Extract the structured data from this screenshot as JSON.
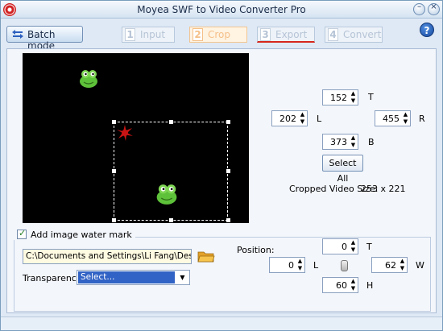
{
  "window": {
    "title": "Moyea SWF to Video Converter Pro"
  },
  "titlebar_buttons": [
    {
      "name": "minimize-button",
      "glyph": "–"
    },
    {
      "name": "close-button",
      "glyph": "×"
    }
  ],
  "toolbar": {
    "batch_mode_label": "Batch mode",
    "help_glyph": "?",
    "steps": [
      {
        "num": "1",
        "label": "Input"
      },
      {
        "num": "2",
        "label": "Crop"
      },
      {
        "num": "3",
        "label": "Export"
      },
      {
        "num": "4",
        "label": "Convert"
      }
    ]
  },
  "crop": {
    "top": "152",
    "top_label": "T",
    "left": "202",
    "left_label": "L",
    "right": "455",
    "right_label": "R",
    "bottom": "373",
    "bottom_label": "B",
    "select_all_label": "Select All",
    "cropped_size_label": "Cropped Video Size:",
    "cropped_size_value": "253 x 221"
  },
  "watermark": {
    "checkbox_label": "Add image water mark",
    "checked": true,
    "path_value": "C:\\Documents and Settings\\Li Fang\\Desktop\\Lo",
    "transparency_label": "Transparency:",
    "transparency_value": "Select...",
    "position_label": "Position:",
    "top": "0",
    "top_label": "T",
    "left": "0",
    "left_label": "L",
    "width": "62",
    "width_label": "W",
    "height": "60",
    "height_label": "H"
  },
  "colors": {
    "accent": "#3162c5",
    "crop_step": "#f5c089",
    "export_underline": "#d6271b",
    "preview_bg": "#000000"
  }
}
